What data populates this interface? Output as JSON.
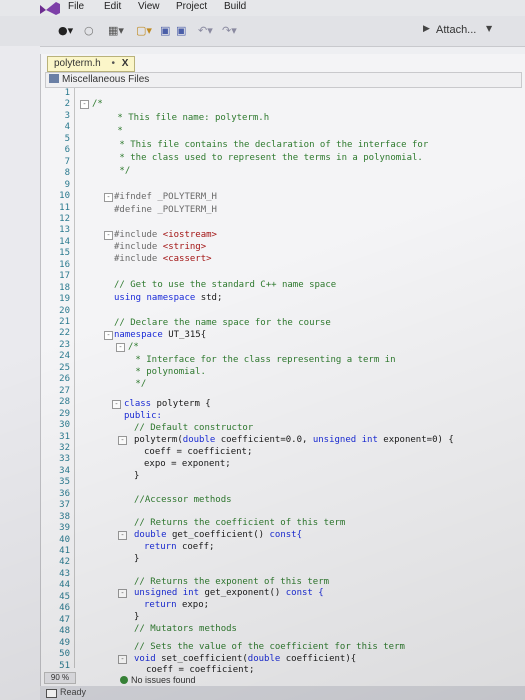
{
  "menu": {
    "file": "File",
    "edit": "Edit",
    "view": "View",
    "project": "Project",
    "build": "Build"
  },
  "toolbar": {
    "attach_label": "Attach..."
  },
  "tab": {
    "title": "polyterm.h",
    "pin": "•",
    "close": "X"
  },
  "navbar": {
    "scope": "Miscellaneous Files"
  },
  "line_numbers": [
    "1",
    "2",
    "3",
    "4",
    "5",
    "6",
    "7",
    "8",
    "9",
    "10",
    "11",
    "12",
    "13",
    "14",
    "15",
    "16",
    "17",
    "18",
    "19",
    "20",
    "21",
    "22",
    "23",
    "24",
    "25",
    "26",
    "27",
    "28",
    "29",
    "30",
    "31",
    "32",
    "33",
    "34",
    "35",
    "36",
    "37",
    "38",
    "39",
    "40",
    "41",
    "42",
    "43",
    "44",
    "45",
    "46",
    "47",
    "48",
    "49",
    "50",
    "51"
  ],
  "code": {
    "l2": "/*",
    "l3": " * This file name: polyterm.h",
    "l4": " *",
    "l5": " * This file contains the declaration of the interface for",
    "l6": " * the class used to represent the terms in a polynomial.",
    "l7": " */",
    "l9": "#ifndef _POLYTERM_H",
    "l10": "#define _POLYTERM_H",
    "l12_a": "#include ",
    "l12_b": "<iostream>",
    "l13_a": "#include ",
    "l13_b": "<string>",
    "l14_a": "#include ",
    "l14_b": "<cassert>",
    "l16": "// Get to use the standard C++ name space",
    "l17_a": "using namespace ",
    "l17_b": "std;",
    "l19": "// Declare the name space for the course",
    "l20_a": "namespace ",
    "l20_b": "UT_315{",
    "l21": "/*",
    "l22": " * Interface for the class representing a term in",
    "l23": " * polynomial.",
    "l24": " */",
    "l26_a": "class ",
    "l26_b": "polyterm {",
    "l27": "public:",
    "l28": "// Default constructor",
    "l29_a": "polyterm(",
    "l29_b": "double ",
    "l29_c": "coefficient=0.0, ",
    "l29_d": "unsigned int ",
    "l29_e": "exponent=0) {",
    "l30": "coeff = coefficient;",
    "l31": "expo = exponent;",
    "l32": "}",
    "l34": "//Accessor methods",
    "l36": "// Returns the coefficient of this term",
    "l37_a": "double ",
    "l37_b": "get_coefficient() ",
    "l37_c": "const{",
    "l38_a": "return ",
    "l38_b": "coeff;",
    "l39": "}",
    "l41": "// Returns the exponent of this term",
    "l42_a": "unsigned int ",
    "l42_b": "get_exponent() ",
    "l42_c": "const {",
    "l43_a": "return ",
    "l43_b": "expo;",
    "l44": "}",
    "l46": "// Mutators methods",
    "l48": "// Sets the value of the coefficient for this term",
    "l49_a": "void ",
    "l49_b": "set_coefficient(",
    "l49_c": "double ",
    "l49_d": "coefficient){",
    "l50": "coeff = coefficient;"
  },
  "status": {
    "zoom": "90 %",
    "issues": "No issues found",
    "ready": "Ready"
  },
  "colors": {
    "keyword": "#1a2bd8",
    "comment": "#2e7a2e",
    "string": "#a31515",
    "line_number": "#2b7a8f"
  }
}
